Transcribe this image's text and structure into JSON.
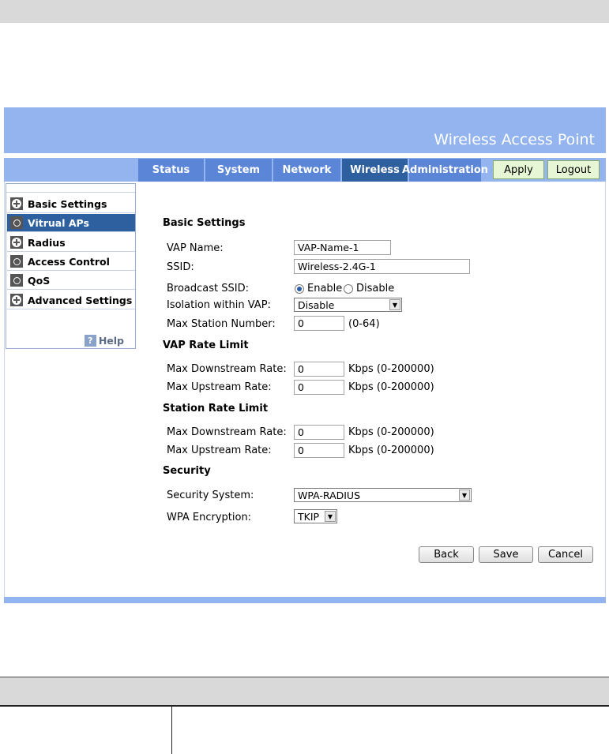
{
  "header": {
    "title": "Wireless Access Point"
  },
  "nav": {
    "tabs": [
      "Status",
      "System",
      "Network",
      "Wireless",
      "Administration"
    ],
    "active_tab": "Wireless",
    "apply_label": "Apply",
    "logout_label": "Logout"
  },
  "sidebar": {
    "items": [
      {
        "label": "Basic Settings",
        "icon": "plus-icon"
      },
      {
        "label": "Vitrual APs",
        "icon": "circle-icon"
      },
      {
        "label": "Radius",
        "icon": "plus-icon"
      },
      {
        "label": "Access Control",
        "icon": "circle-icon"
      },
      {
        "label": "QoS",
        "icon": "circle-icon"
      },
      {
        "label": "Advanced Settings",
        "icon": "plus-icon"
      }
    ],
    "active_item": "Vitrual APs",
    "help_label": "Help",
    "help_icon": "?"
  },
  "form": {
    "basic": {
      "title": "Basic Settings",
      "vap_name_label": "VAP Name:",
      "vap_name_value": "VAP-Name-1",
      "ssid_label": "SSID:",
      "ssid_value": "Wireless-2.4G-1",
      "broadcast_label": "Broadcast SSID:",
      "broadcast_enable": "Enable",
      "broadcast_disable": "Disable",
      "broadcast_selected": "Enable",
      "isolation_label": "Isolation within VAP:",
      "isolation_value": "Disable",
      "max_station_label": "Max Station Number:",
      "max_station_value": "0",
      "max_station_range": "(0-64)"
    },
    "vap_rate": {
      "title": "VAP Rate Limit",
      "down_label": "Max Downstream Rate:",
      "down_value": "0",
      "up_label": "Max Upstream Rate:",
      "up_value": "0",
      "unit": "Kbps (0-200000)"
    },
    "station_rate": {
      "title": "Station Rate Limit",
      "down_label": "Max Downstream Rate:",
      "down_value": "0",
      "up_label": "Max Upstream Rate:",
      "up_value": "0",
      "unit": "Kbps (0-200000)"
    },
    "security": {
      "title": "Security",
      "system_label": "Security System:",
      "system_value": "WPA-RADIUS",
      "encryption_label": "WPA Encryption:",
      "encryption_value": "TKIP"
    },
    "buttons": {
      "back": "Back",
      "save": "Save",
      "cancel": "Cancel"
    }
  },
  "colors": {
    "header_bg": "#93b4ee",
    "tab_bg": "#5b86d8",
    "active_bg": "#2e5f9e",
    "apply_bg": "#e7f6d5"
  }
}
